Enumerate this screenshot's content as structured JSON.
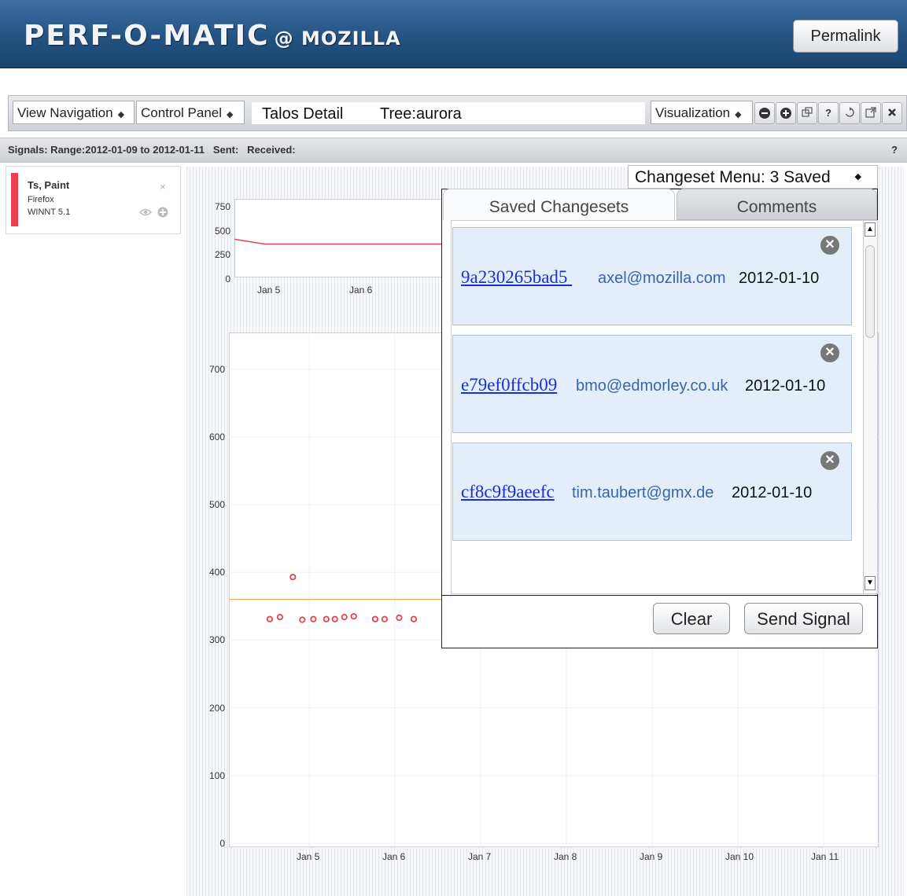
{
  "header": {
    "logo_main": "PERF-O-MATIC",
    "logo_sub": "@ MOZILLA",
    "permalink_label": "Permalink"
  },
  "toolbar": {
    "view_navigation": "View Navigation",
    "control_panel": "Control Panel",
    "title_left": "Talos Detail",
    "title_right": "Tree:aurora",
    "visualization": "Visualization",
    "help_label": "?"
  },
  "signals": {
    "text": "Signals: Range:2012-01-09 to 2012-01-11   Sent:   Received:",
    "help": "?"
  },
  "legend": {
    "color": "#e8414f",
    "title": "Ts, Paint",
    "product": "Firefox",
    "platform": "WINNT 5.1",
    "close": "×"
  },
  "changesets": {
    "menu_label": "Changeset Menu: 3 Saved",
    "tabs": [
      "Saved Changesets",
      "Comments"
    ],
    "items": [
      {
        "hash": "9a230265bad5 ",
        "email": "axel@mozilla.com",
        "date": "2012-01-10"
      },
      {
        "hash": "e79ef0ffcb09",
        "email": "bmo@edmorley.co.uk",
        "date": "2012-01-10"
      },
      {
        "hash": "cf8c9f9aeefc",
        "email": "tim.taubert@gmx.de",
        "date": "2012-01-10"
      }
    ],
    "clear_label": "Clear",
    "send_label": "Send Signal"
  },
  "chart_data": [
    {
      "type": "line",
      "title": "",
      "x_ticks": [
        "Jan 5",
        "Jan 6"
      ],
      "y_ticks": [
        0,
        250,
        500,
        750
      ],
      "ylim": [
        0,
        750
      ],
      "series": [
        {
          "color": "#e8414f",
          "values": [
            380,
            330,
            330,
            330,
            330,
            330,
            330,
            330
          ]
        }
      ]
    },
    {
      "type": "scatter",
      "title": "",
      "x_ticks": [
        "Jan 5",
        "Jan 6",
        "Jan 7",
        "Jan 8",
        "Jan 9",
        "Jan 10",
        "Jan 11"
      ],
      "y_ticks": [
        0,
        100,
        200,
        300,
        400,
        500,
        600,
        700
      ],
      "ylim": [
        0,
        750
      ],
      "reference_line": {
        "value": 360,
        "color": "#e8a050"
      },
      "point_color": "#e8414f",
      "points": [
        {
          "x": 4.54,
          "y": 331
        },
        {
          "x": 4.66,
          "y": 334
        },
        {
          "x": 4.81,
          "y": 393
        },
        {
          "x": 4.92,
          "y": 330
        },
        {
          "x": 5.05,
          "y": 331
        },
        {
          "x": 5.2,
          "y": 331
        },
        {
          "x": 5.3,
          "y": 331
        },
        {
          "x": 5.41,
          "y": 334
        },
        {
          "x": 5.52,
          "y": 335
        },
        {
          "x": 5.77,
          "y": 331
        },
        {
          "x": 5.88,
          "y": 331
        },
        {
          "x": 6.05,
          "y": 333
        },
        {
          "x": 6.22,
          "y": 331
        }
      ]
    }
  ]
}
